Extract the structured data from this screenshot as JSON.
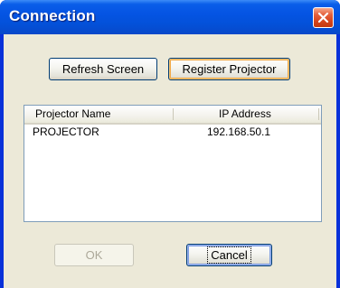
{
  "window": {
    "title": "Connection",
    "close_icon": "close-icon"
  },
  "toolbar": {
    "refresh_label": "Refresh Screen",
    "register_label": "Register Projector"
  },
  "projector_list": {
    "columns": [
      "Projector Name",
      "IP Address"
    ],
    "rows": [
      {
        "name": "PROJECTOR",
        "ip": "192.168.50.1"
      }
    ]
  },
  "footer": {
    "ok_label": "OK",
    "cancel_label": "Cancel"
  },
  "colors": {
    "title_bar": "#0554e3",
    "client_bg": "#ece9d8",
    "close_button": "#d6441c",
    "focus_highlight": "#f0a94a"
  }
}
